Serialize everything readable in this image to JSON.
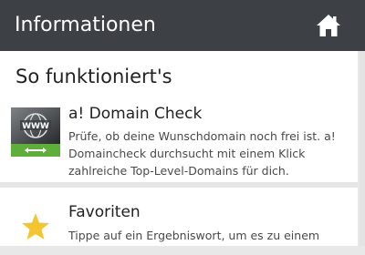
{
  "header": {
    "title": "Informationen",
    "home_icon": "home-icon"
  },
  "section": {
    "title": "So funktioniert's"
  },
  "items": [
    {
      "title": "a! Domain Check",
      "description": "Prüfe, ob deine Wunschdomain noch frei ist. a! Domaincheck durchsucht mit einem Klick zahlreiche Top-Level-Domains für dich.",
      "icon": "www-domain-check-icon"
    },
    {
      "title": "Favoriten",
      "description": "Tippe auf ein Ergebniswort, um es zu einem",
      "icon": "star-icon"
    }
  ],
  "colors": {
    "header_bg": "#3d4145",
    "domain_icon_green": "#5fae3c",
    "star": "#f2c531"
  }
}
